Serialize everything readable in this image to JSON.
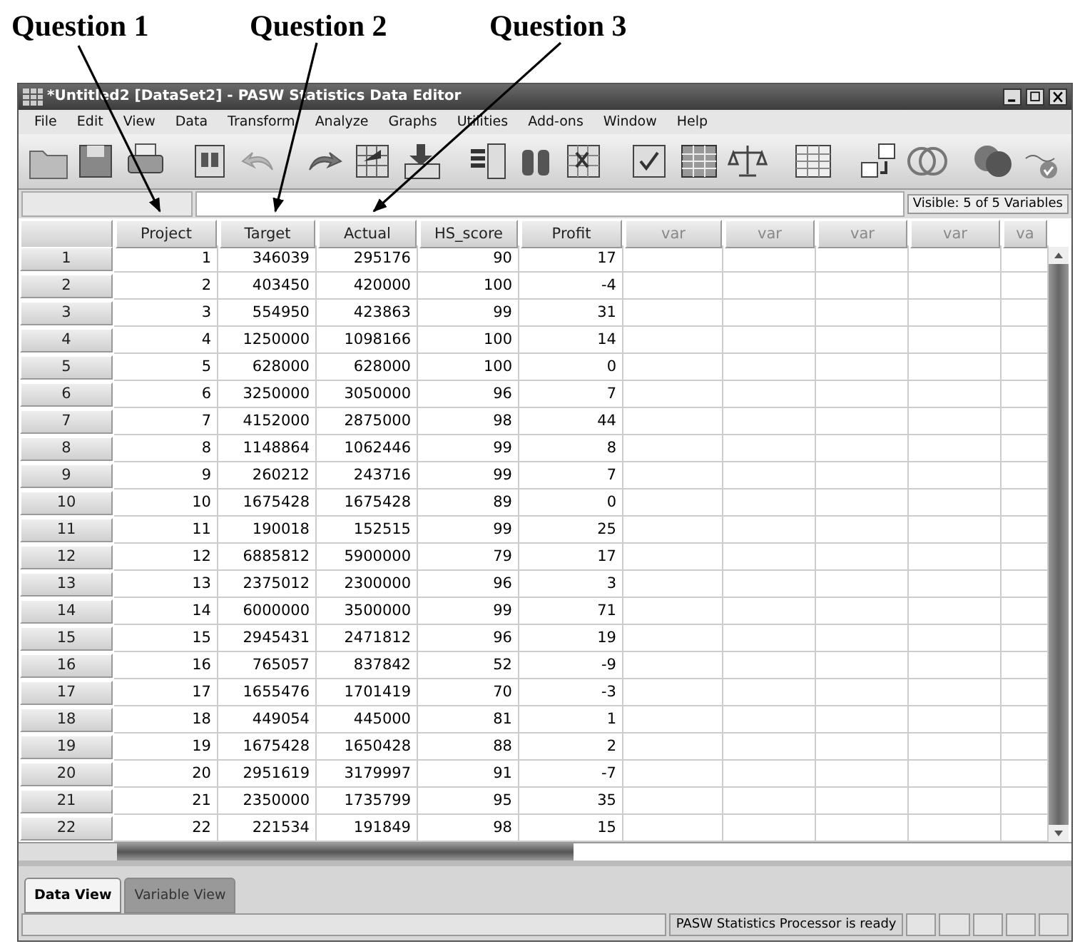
{
  "annotations": [
    {
      "label": "Question 1"
    },
    {
      "label": "Question 2"
    },
    {
      "label": "Question 3"
    }
  ],
  "window": {
    "title": "*Untitled2 [DataSet2] - PASW Statistics Data Editor"
  },
  "menu": [
    "File",
    "Edit",
    "View",
    "Data",
    "Transform",
    "Analyze",
    "Graphs",
    "Utilities",
    "Add-ons",
    "Window",
    "Help"
  ],
  "cell_editor": {
    "visible_label": "Visible: 5 of 5 Variables"
  },
  "table": {
    "columns": [
      "Project",
      "Target",
      "Actual",
      "HS_score",
      "Profit",
      "var",
      "var",
      "var",
      "var",
      "va"
    ],
    "rows": [
      {
        "case": "1",
        "cells": [
          "1",
          "346039",
          "295176",
          "90",
          "17"
        ]
      },
      {
        "case": "2",
        "cells": [
          "2",
          "403450",
          "420000",
          "100",
          "-4"
        ]
      },
      {
        "case": "3",
        "cells": [
          "3",
          "554950",
          "423863",
          "99",
          "31"
        ]
      },
      {
        "case": "4",
        "cells": [
          "4",
          "1250000",
          "1098166",
          "100",
          "14"
        ]
      },
      {
        "case": "5",
        "cells": [
          "5",
          "628000",
          "628000",
          "100",
          "0"
        ]
      },
      {
        "case": "6",
        "cells": [
          "6",
          "3250000",
          "3050000",
          "96",
          "7"
        ]
      },
      {
        "case": "7",
        "cells": [
          "7",
          "4152000",
          "2875000",
          "98",
          "44"
        ]
      },
      {
        "case": "8",
        "cells": [
          "8",
          "1148864",
          "1062446",
          "99",
          "8"
        ]
      },
      {
        "case": "9",
        "cells": [
          "9",
          "260212",
          "243716",
          "99",
          "7"
        ]
      },
      {
        "case": "10",
        "cells": [
          "10",
          "1675428",
          "1675428",
          "89",
          "0"
        ]
      },
      {
        "case": "11",
        "cells": [
          "11",
          "190018",
          "152515",
          "99",
          "25"
        ]
      },
      {
        "case": "12",
        "cells": [
          "12",
          "6885812",
          "5900000",
          "79",
          "17"
        ]
      },
      {
        "case": "13",
        "cells": [
          "13",
          "2375012",
          "2300000",
          "96",
          "3"
        ]
      },
      {
        "case": "14",
        "cells": [
          "14",
          "6000000",
          "3500000",
          "99",
          "71"
        ]
      },
      {
        "case": "15",
        "cells": [
          "15",
          "2945431",
          "2471812",
          "96",
          "19"
        ]
      },
      {
        "case": "16",
        "cells": [
          "16",
          "765057",
          "837842",
          "52",
          "-9"
        ]
      },
      {
        "case": "17",
        "cells": [
          "17",
          "1655476",
          "1701419",
          "70",
          "-3"
        ]
      },
      {
        "case": "18",
        "cells": [
          "18",
          "449054",
          "445000",
          "81",
          "1"
        ]
      },
      {
        "case": "19",
        "cells": [
          "19",
          "1675428",
          "1650428",
          "88",
          "2"
        ]
      },
      {
        "case": "20",
        "cells": [
          "20",
          "2951619",
          "3179997",
          "91",
          "-7"
        ]
      },
      {
        "case": "21",
        "cells": [
          "21",
          "2350000",
          "1735799",
          "95",
          "35"
        ]
      },
      {
        "case": "22",
        "cells": [
          "22",
          "221534",
          "191849",
          "98",
          "15"
        ]
      }
    ]
  },
  "tabs": [
    {
      "label": "Data View",
      "selected": true
    },
    {
      "label": "Variable View",
      "selected": false
    }
  ],
  "status_bar": {
    "message": "PASW Statistics Processor is ready"
  }
}
